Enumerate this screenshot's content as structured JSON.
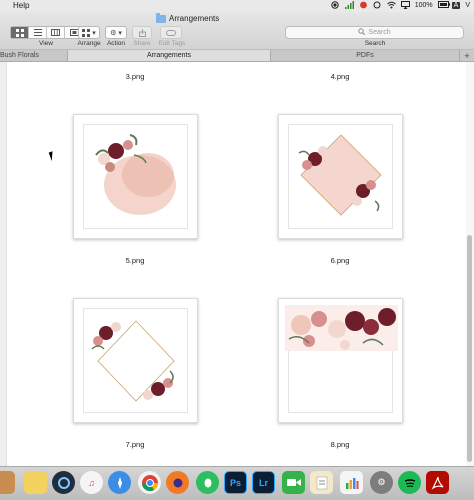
{
  "menubar": {
    "help": "Help",
    "battery": "100%",
    "user": "A"
  },
  "window": {
    "title": "Arrangements"
  },
  "toolbar": {
    "view_label": "View",
    "arrange_label": "Arrange",
    "action_label": "Action",
    "share_label": "Share",
    "edit_tags_label": "Edit Tags",
    "search_label": "Search",
    "search_placeholder": "Search"
  },
  "tabs": [
    {
      "label": "Bush Florals"
    },
    {
      "label": "Arrangements"
    },
    {
      "label": "PDFs"
    },
    {
      "label": "+"
    }
  ],
  "files": [
    {
      "name": "3.png"
    },
    {
      "name": "4.png"
    },
    {
      "name": "5.png"
    },
    {
      "name": "6.png"
    },
    {
      "name": "7.png"
    },
    {
      "name": "8.png"
    }
  ],
  "colors": {
    "blush": "#f0c6ba",
    "burgundy": "#6e1d2b",
    "rose": "#d78f8f",
    "leaf": "#5f7a55",
    "gold": "#c9a36a"
  },
  "dock": {
    "apps": [
      "finder-icon",
      "notes-icon",
      "quicktime-icon",
      "itunes-icon",
      "safari-icon",
      "chrome-icon",
      "firefox-icon",
      "evernote-icon",
      "photoshop-icon",
      "lightroom-icon",
      "facetime-icon",
      "textedit-icon",
      "numbers-icon",
      "system-preferences-icon",
      "spotify-icon",
      "acrobat-icon"
    ],
    "ps_text": "Ps",
    "lr_text": "Lr"
  }
}
